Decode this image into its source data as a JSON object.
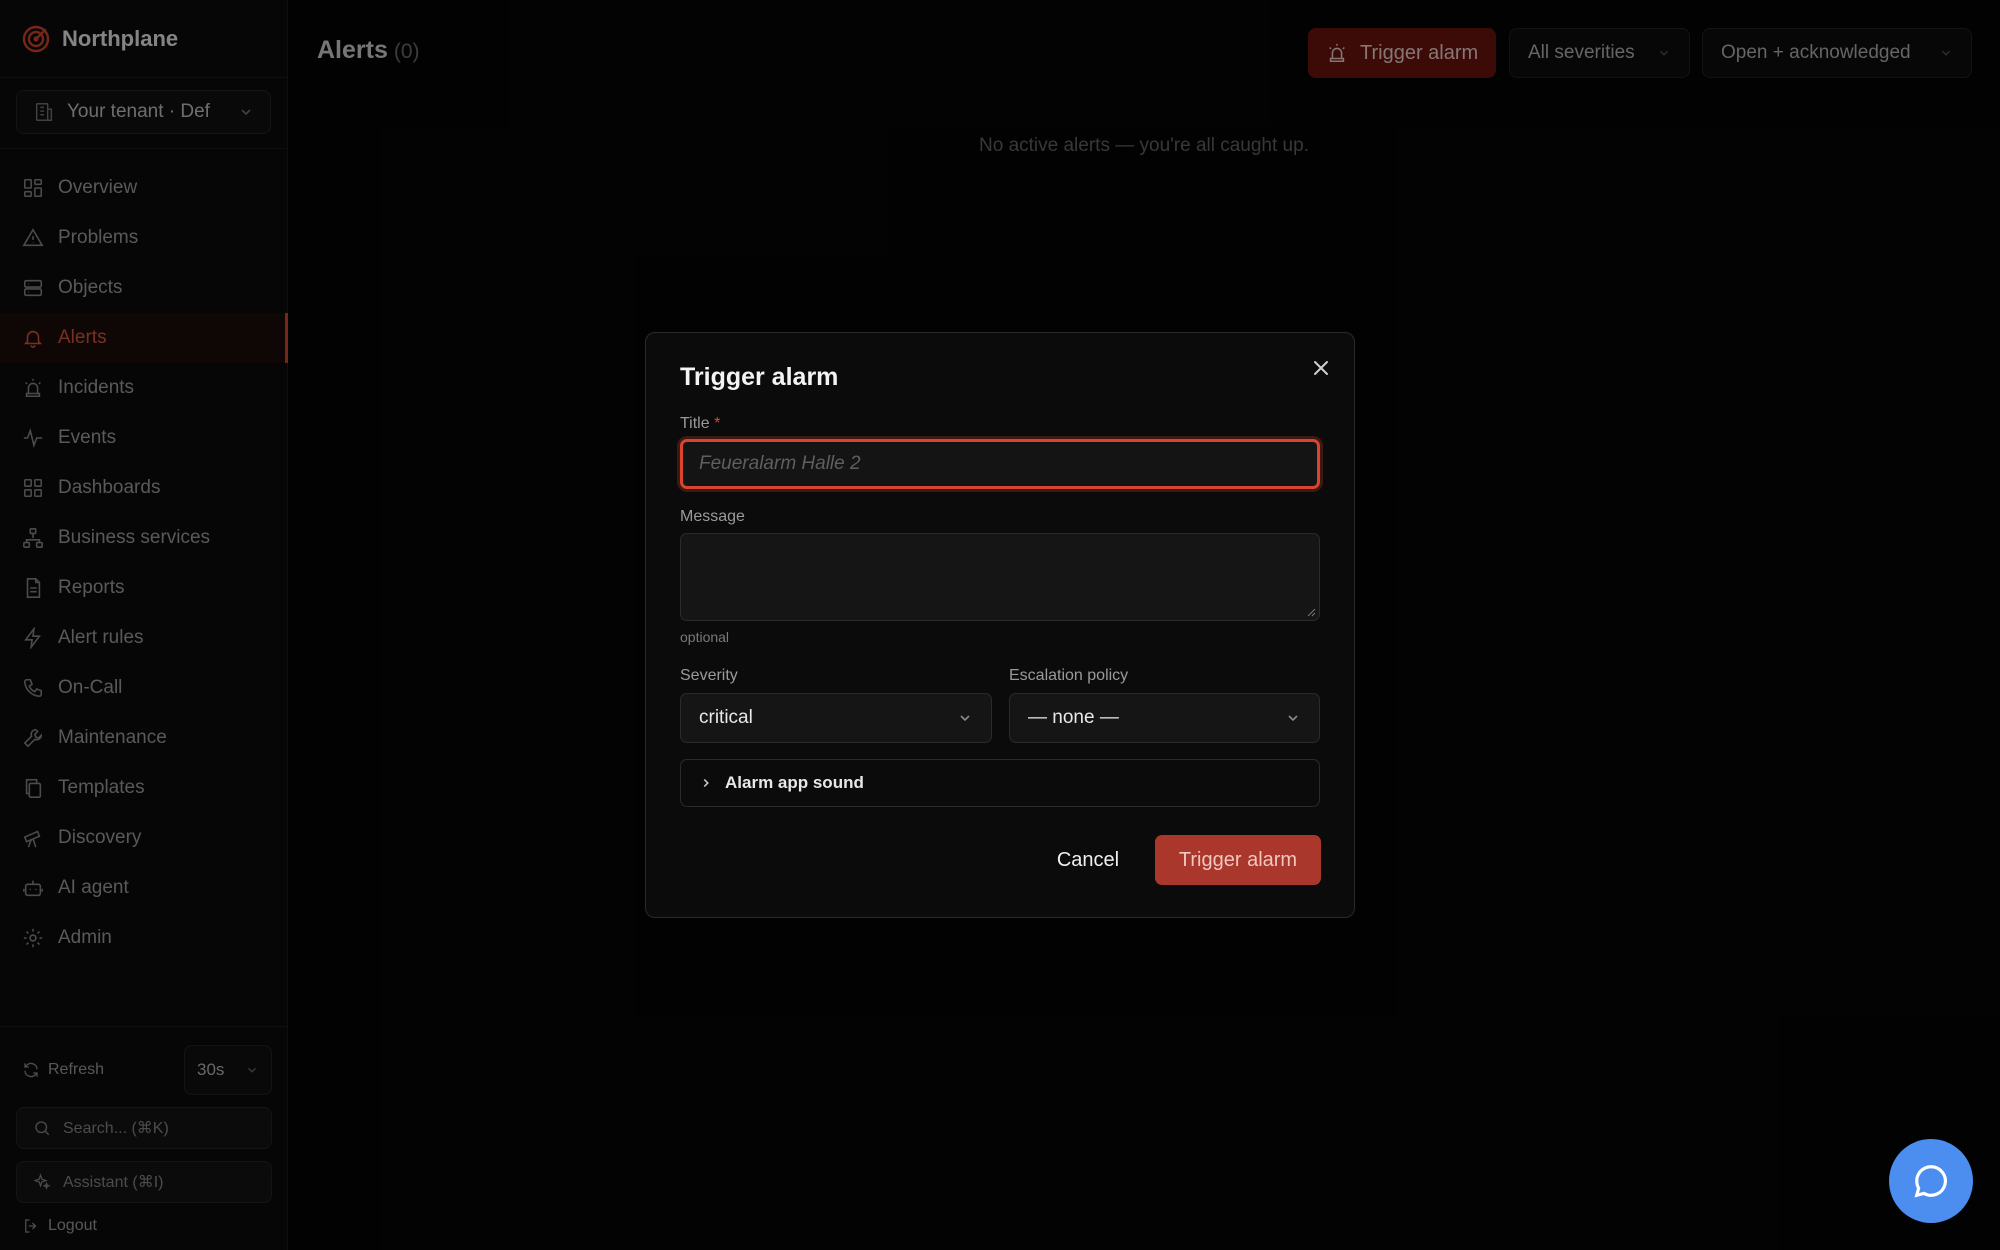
{
  "app": {
    "name": "Northplane"
  },
  "tenant": {
    "label": "Your tenant · Def"
  },
  "nav": [
    {
      "label": "Overview",
      "icon": "grid-icon",
      "active": false
    },
    {
      "label": "Problems",
      "icon": "warning-icon",
      "active": false
    },
    {
      "label": "Objects",
      "icon": "server-icon",
      "active": false
    },
    {
      "label": "Alerts",
      "icon": "bell-icon",
      "active": true
    },
    {
      "label": "Incidents",
      "icon": "siren-icon",
      "active": false
    },
    {
      "label": "Events",
      "icon": "activity-icon",
      "active": false
    },
    {
      "label": "Dashboards",
      "icon": "dashboard-icon",
      "active": false
    },
    {
      "label": "Business services",
      "icon": "network-icon",
      "active": false
    },
    {
      "label": "Reports",
      "icon": "document-icon",
      "active": false
    },
    {
      "label": "Alert rules",
      "icon": "lightning-icon",
      "active": false
    },
    {
      "label": "On-Call",
      "icon": "phone-icon",
      "active": false
    },
    {
      "label": "Maintenance",
      "icon": "wrench-icon",
      "active": false
    },
    {
      "label": "Templates",
      "icon": "copy-icon",
      "active": false
    },
    {
      "label": "Discovery",
      "icon": "telescope-icon",
      "active": false
    },
    {
      "label": "AI agent",
      "icon": "bot-icon",
      "active": false
    },
    {
      "label": "Admin",
      "icon": "gear-icon",
      "active": false
    }
  ],
  "sidebar_bottom": {
    "refresh_label": "Refresh",
    "interval": "30s",
    "search_placeholder": "Search... (⌘K)",
    "assistant_label": "Assistant (⌘I)",
    "logout_label": "Logout"
  },
  "header": {
    "title": "Alerts",
    "count": "(0)",
    "trigger_label": "Trigger alarm",
    "severity_filter": "All severities",
    "state_filter": "Open + acknowledged"
  },
  "empty_state": "No active alerts — you're all caught up.",
  "modal": {
    "title": "Trigger alarm",
    "title_label": "Title",
    "required_mark": "*",
    "title_placeholder": "Feueralarm Halle 2",
    "message_label": "Message",
    "message_hint": "optional",
    "severity_label": "Severity",
    "severity_value": "critical",
    "escalation_label": "Escalation policy",
    "escalation_value": "— none —",
    "sound_label": "Alarm app sound",
    "cancel_label": "Cancel",
    "submit_label": "Trigger alarm"
  },
  "colors": {
    "accent": "#d9452c",
    "active_nav_text": "#e2573d",
    "trigger_top_bg": "#6e1510",
    "submit_bg": "#a9372b",
    "chat_fab": "#4b8ef0",
    "background": "#050505"
  }
}
